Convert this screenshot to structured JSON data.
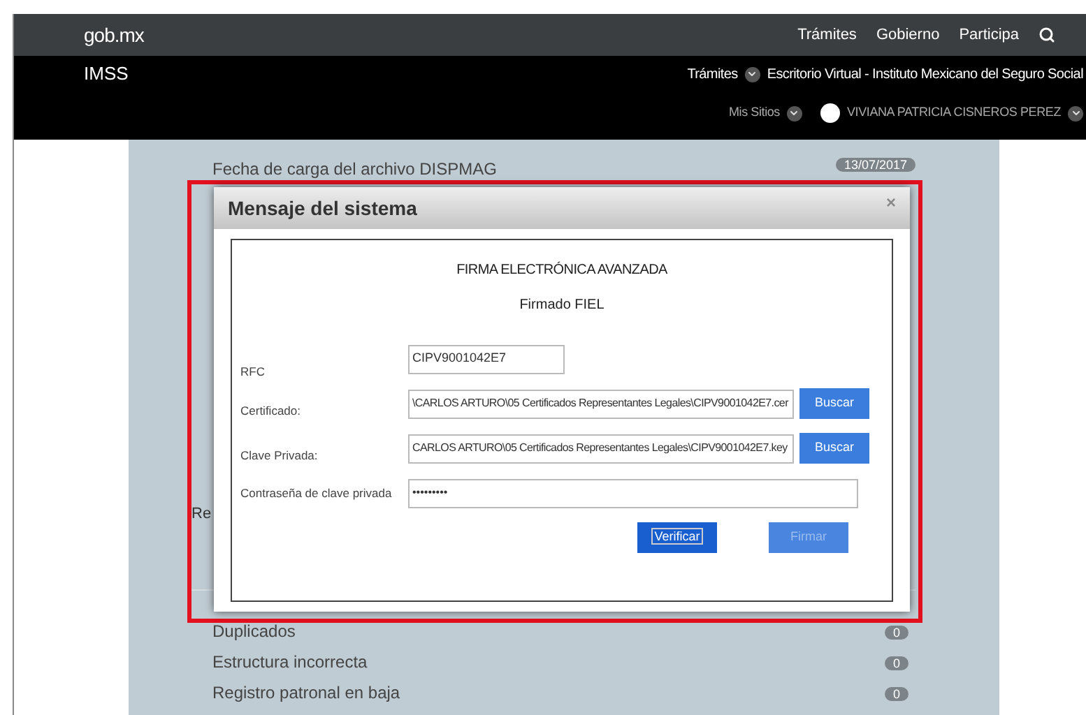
{
  "top_bar": {
    "logo": "gob.mx",
    "links": [
      "Trámites",
      "Gobierno",
      "Participa"
    ]
  },
  "site_bar": {
    "title": "IMSS",
    "menu": "Trámites",
    "site_name": "Escritorio Virtual - Instituto Mexicano del Seguro Social",
    "my_sites": "Mis Sitios",
    "user": "VIVIANA PATRICIA CISNEROS PEREZ"
  },
  "panel": {
    "header_row": {
      "label": "Fecha de carga del archivo DISPMAG",
      "badge": "13/07/2017"
    },
    "section_label": "Re",
    "rows": [
      {
        "label": "Duplicados",
        "badge": "0"
      },
      {
        "label": "Estructura incorrecta",
        "badge": "0"
      },
      {
        "label": "Registro patronal en baja",
        "badge": "0"
      }
    ]
  },
  "modal": {
    "title": "Mensaje del sistema",
    "close": "×",
    "heading": "FIRMA ELECTRÓNICA AVANZADA",
    "subheading": "Firmado FIEL",
    "fields": [
      {
        "kind": "text",
        "label": "RFC",
        "value": "CIPV9001042E7"
      },
      {
        "kind": "file",
        "label": "Certificado:",
        "value": "\\CARLOS ARTURO\\05 Certificados Representantes Legales\\CIPV9001042E7.cer",
        "button": "Buscar"
      },
      {
        "kind": "file",
        "label": "Clave Privada:",
        "value": "CARLOS ARTURO\\05 Certificados Representantes Legales\\CIPV9001042E7.key",
        "button": "Buscar"
      },
      {
        "kind": "password",
        "label": "Contraseña de clave privada",
        "value": "•••••••••"
      }
    ],
    "actions": [
      {
        "label": "Verificar",
        "disabled": false
      },
      {
        "label": "Firmar",
        "disabled": true
      }
    ]
  }
}
